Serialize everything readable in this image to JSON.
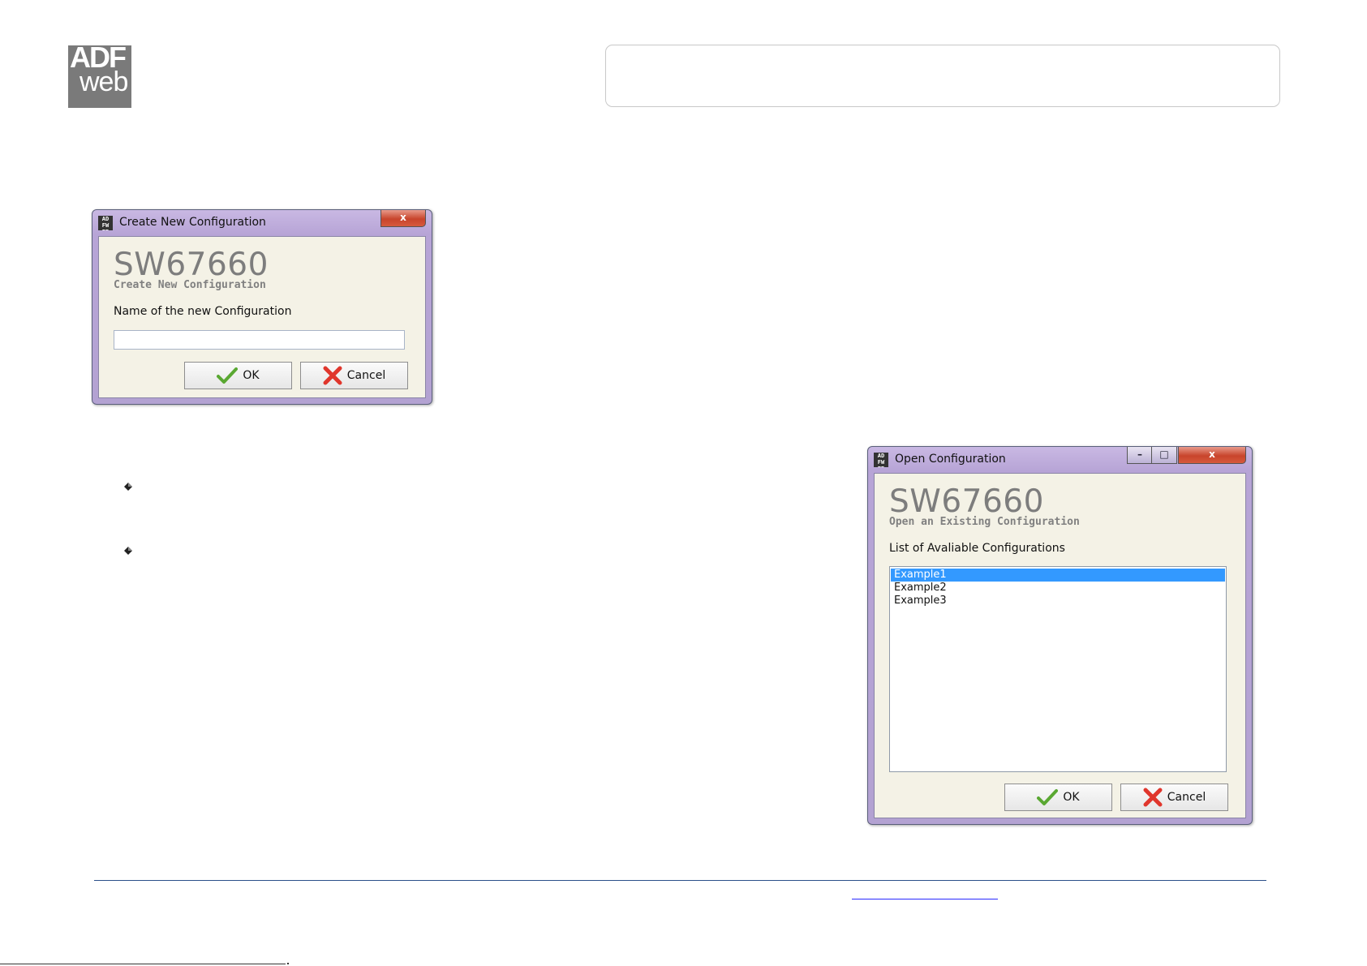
{
  "logo": {
    "line1": "ADF",
    "line2": "web"
  },
  "create_dialog": {
    "title": "Create New Configuration",
    "close_label": "x",
    "app_name": "SW67660",
    "subtitle": "Create New Configuration",
    "field_label": "Name of the new Configuration",
    "field_value": "",
    "ok_label": "OK",
    "cancel_label": "Cancel"
  },
  "open_dialog": {
    "title": "Open Configuration",
    "minimize_label": "–",
    "maximize_label": "□",
    "close_label": "x",
    "app_name": "SW67660",
    "subtitle": "Open an Existing Configuration",
    "list_label": "List of Avaliable Configurations",
    "items": [
      "Example1",
      "Example2",
      "Example3"
    ],
    "selected_index": 0,
    "ok_label": "OK",
    "cancel_label": "Cancel"
  },
  "colors": {
    "title_bar": "#b7a4d6",
    "client_bg": "#f4f2e6",
    "selection": "#3399ff",
    "close_button": "#c8442c",
    "footer_rule": "#2b4f8a",
    "link": "#2a2aff"
  },
  "icons": {
    "bullet": "diamond-bullet-icon",
    "ok": "green-check-icon",
    "cancel": "red-x-icon"
  }
}
